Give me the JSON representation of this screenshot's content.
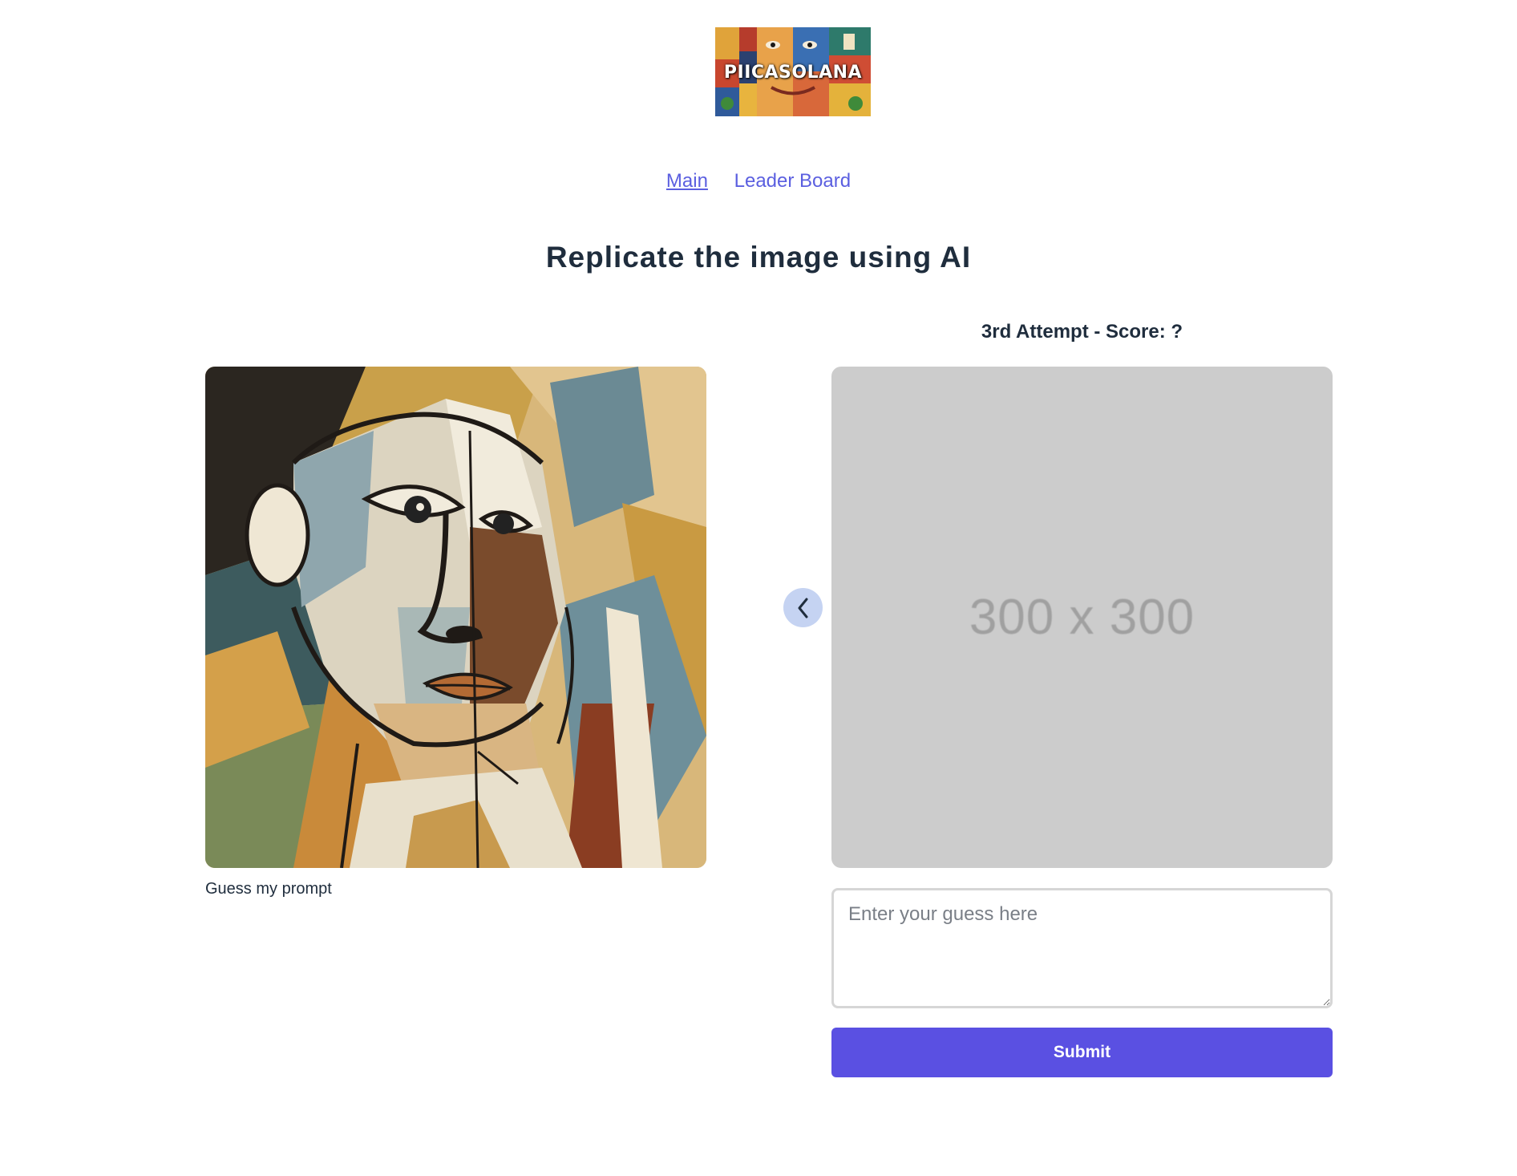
{
  "logo": {
    "text": "PIICASOLANA"
  },
  "nav": {
    "items": [
      {
        "label": "Main",
        "active": true
      },
      {
        "label": "Leader Board",
        "active": false
      }
    ]
  },
  "heading": "Replicate the image using AI",
  "target": {
    "caption": "Guess my prompt"
  },
  "attempt": {
    "title": "3rd Attempt - Score: ?",
    "placeholder_text": "300 x 300"
  },
  "guess": {
    "placeholder": "Enter your guess here",
    "value": ""
  },
  "submit": {
    "label": "Submit"
  },
  "colors": {
    "link": "#5b5fe0",
    "button": "#5a50e2",
    "placeholder_bg": "#cccccc",
    "prev_button_bg": "#c5d3f2"
  },
  "icons": {
    "prev": "chevron-left-icon"
  }
}
